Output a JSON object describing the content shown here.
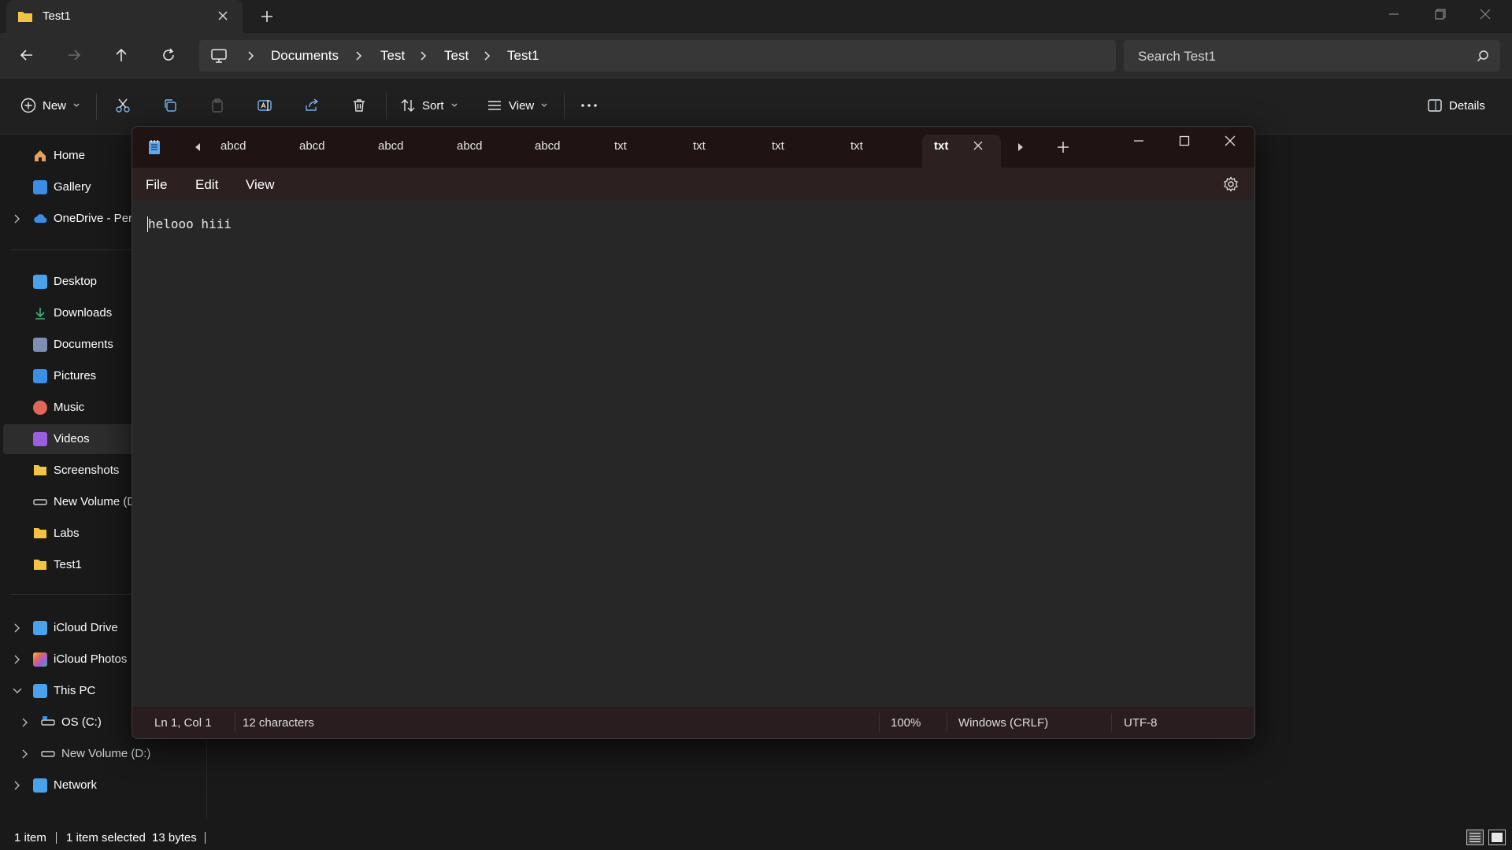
{
  "explorer": {
    "tab_title": "Test1",
    "breadcrumb": [
      "Documents",
      "Test",
      "Test",
      "Test1"
    ],
    "search_placeholder": "Search Test1",
    "commands": {
      "new_label": "New",
      "sort_label": "Sort",
      "view_label": "View",
      "details_label": "Details"
    },
    "nav": {
      "home": "Home",
      "gallery": "Gallery",
      "onedrive": "OneDrive - Pers",
      "desktop": "Desktop",
      "downloads": "Downloads",
      "documents": "Documents",
      "pictures": "Pictures",
      "music": "Music",
      "videos": "Videos",
      "screenshots": "Screenshots",
      "new_volume_d_short": "New Volume (D",
      "labs": "Labs",
      "test1": "Test1",
      "icloud_drive": "iCloud Drive",
      "icloud_photos": "iCloud Photos",
      "this_pc": "This PC",
      "os_c": "OS (C:)",
      "new_volume_d": "New Volume (D:)",
      "network": "Network"
    },
    "status": {
      "items": "1 item",
      "selected": "1 item selected",
      "size": "13 bytes"
    }
  },
  "notepad": {
    "tabs": [
      "abcd",
      "abcd",
      "abcd",
      "abcd",
      "abcd",
      "txt",
      "txt",
      "txt",
      "txt"
    ],
    "active_tab": "txt",
    "menu": {
      "file": "File",
      "edit": "Edit",
      "view": "View"
    },
    "content": "helooo hiii",
    "status": {
      "position": "Ln 1, Col 1",
      "characters": "12 characters",
      "zoom": "100%",
      "line_ending": "Windows (CRLF)",
      "encoding": "UTF-8"
    }
  },
  "colors": {
    "background": "#191919",
    "accent_folder": "#f5c343",
    "notepad_tint": "#2c2020"
  }
}
